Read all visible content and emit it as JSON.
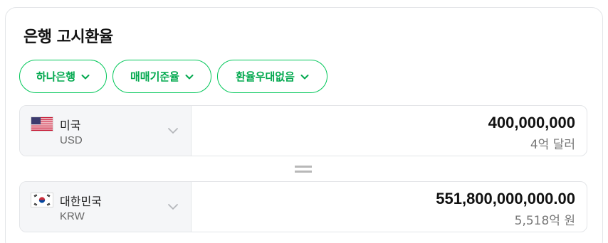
{
  "title": "은행 고시환율",
  "filters": [
    {
      "label": "하나은행"
    },
    {
      "label": "매매기준율"
    },
    {
      "label": "환율우대없음"
    }
  ],
  "from": {
    "name": "미국",
    "code": "USD",
    "flag": "us-flag",
    "amount": "400,000,000",
    "amount_words": "4억 달러"
  },
  "to": {
    "name": "대한민국",
    "code": "KRW",
    "flag": "kr-flag",
    "amount": "551,800,000,000.00",
    "amount_words": "5,518억 원"
  },
  "colors": {
    "accent": "#03c75a",
    "accent_text": "#03a94f",
    "panel_bg": "#f5f6f8",
    "border": "#e3e5e8"
  }
}
